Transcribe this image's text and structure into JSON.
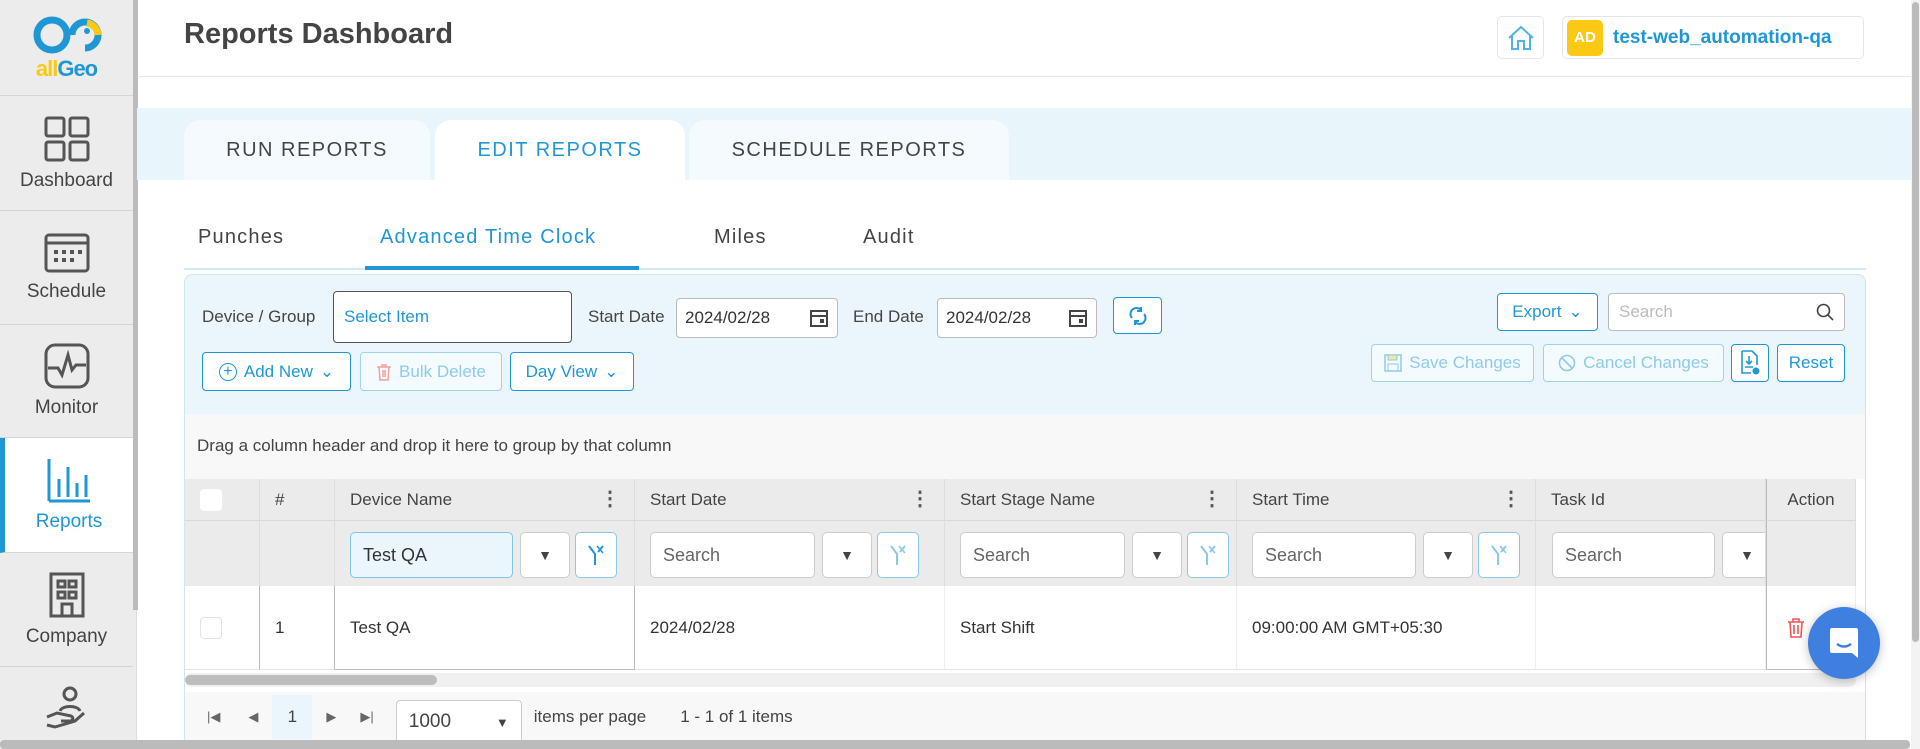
{
  "brand": {
    "logo_text_a": "all",
    "logo_text_b": "Geo",
    "colors": {
      "blue": "#1f97d4",
      "yellow": "#fbc913"
    }
  },
  "sidebar": {
    "items": [
      {
        "label": "Dashboard",
        "icon": "grid-icon"
      },
      {
        "label": "Schedule",
        "icon": "calendar-icon"
      },
      {
        "label": "Monitor",
        "icon": "pulse-icon"
      },
      {
        "label": "Reports",
        "icon": "bar-chart-icon",
        "active": true
      },
      {
        "label": "Company",
        "icon": "building-icon"
      },
      {
        "label": "",
        "icon": "hand-user-icon"
      }
    ]
  },
  "header": {
    "title": "Reports Dashboard",
    "avatar": "AD",
    "user": "test-web_automation-qa"
  },
  "tabs": [
    {
      "label": "RUN REPORTS"
    },
    {
      "label": "EDIT REPORTS",
      "active": true
    },
    {
      "label": "SCHEDULE REPORTS"
    }
  ],
  "subtabs": [
    {
      "label": "Punches"
    },
    {
      "label": "Advanced Time Clock",
      "active": true
    },
    {
      "label": "Miles"
    },
    {
      "label": "Audit"
    }
  ],
  "toolbar": {
    "device_group_label": "Device / Group",
    "device_group_placeholder": "Select Item",
    "start_date_label": "Start Date",
    "start_date": "2024/02/28",
    "end_date_label": "End Date",
    "end_date": "2024/02/28",
    "export": "Export",
    "search_placeholder": "Search",
    "add_new": "Add New",
    "bulk_delete": "Bulk Delete",
    "day_view": "Day View",
    "save_changes": "Save Changes",
    "cancel_changes": "Cancel Changes",
    "reset": "Reset"
  },
  "grid": {
    "group_hint": "Drag a column header and drop it here to group by that column",
    "columns": [
      "#",
      "Device Name",
      "Start Date",
      "Start Stage Name",
      "Start Time",
      "Task Id",
      "Action"
    ],
    "filters": {
      "device": "Test QA",
      "placeholder": "Search"
    },
    "rows": [
      {
        "num": "1",
        "device": "Test QA",
        "start_date": "2024/02/28",
        "stage": "Start Shift",
        "start_time": "09:00:00 AM GMT+05:30",
        "task_id": ""
      }
    ]
  },
  "pager": {
    "page": "1",
    "page_size": "1000",
    "items_per_page": "items per page",
    "summary": "1 - 1 of 1 items"
  }
}
